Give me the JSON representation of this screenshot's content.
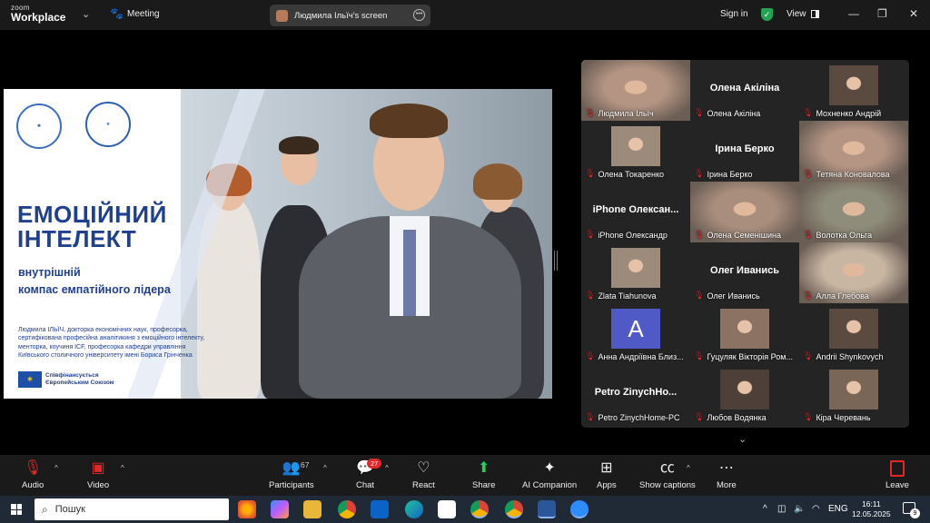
{
  "topbar": {
    "logo_line1": "zoom",
    "logo_line2": "Workplace",
    "meeting_label": "Meeting",
    "screen_share_label": "Людмила Ільїч's screen",
    "sign_in": "Sign in",
    "view_label": "View",
    "minimize": "—",
    "restore": "❐",
    "close": "✕"
  },
  "slide": {
    "title_line1": "ЕМОЦІЙНИЙ",
    "title_line2": "ІНТЕЛЕКТ",
    "subtitle_line1": "внутрішній",
    "subtitle_line2": "компас емпатійного лідера",
    "author_line1": "Людмила ІЛЬЇЧ, докторка економічних наук, професорка,",
    "author_line2": "сертифікована професійна аналітикиня з емоційного інтелекту,",
    "author_line3": "менторка, коучиня ICF, професорка кафедри управління",
    "author_line4": "Київського столичного університету імені Бориса Грінченка",
    "eu_line1": "Співфінансується",
    "eu_line2": "Європейським Союзом"
  },
  "gallery": {
    "tiles": [
      {
        "name": "Людмила Ільїч",
        "kind": "video",
        "active": true
      },
      {
        "name": "Олена Акіліна",
        "kind": "name",
        "big": "Олена Акіліна"
      },
      {
        "name": "Мохненко Андрій",
        "kind": "photo"
      },
      {
        "name": "Олена Токаренко",
        "kind": "photo"
      },
      {
        "name": "Ірина Берко",
        "kind": "name",
        "big": "Ірина Берко"
      },
      {
        "name": "Тетяна Коновалова",
        "kind": "video"
      },
      {
        "name": "iPhone Олександр",
        "kind": "name",
        "big": "iPhone Олексан..."
      },
      {
        "name": "Олена Семенішина",
        "kind": "video"
      },
      {
        "name": "Волотка Ольга",
        "kind": "video"
      },
      {
        "name": "Zlata Tiahunova",
        "kind": "photo"
      },
      {
        "name": "Олег Иванись",
        "kind": "name",
        "big": "Олег Иванись"
      },
      {
        "name": "Алла Глебова",
        "kind": "video"
      },
      {
        "name": "Анна Андріївна Близ...",
        "kind": "avatar",
        "letter": "A"
      },
      {
        "name": "Гуцуляк Вікторія Ром...",
        "kind": "photo"
      },
      {
        "name": "Andrii Shynkovych",
        "kind": "photo"
      },
      {
        "name": "Petro ZinychHome-PC",
        "kind": "name",
        "big": "Petro  ZinychHo..."
      },
      {
        "name": "Любов Водянка",
        "kind": "photo"
      },
      {
        "name": "Кіра Черевань",
        "kind": "photo"
      }
    ]
  },
  "toolbar": {
    "audio": "Audio",
    "video": "Video",
    "participants": "Participants",
    "participants_count": "67",
    "chat": "Chat",
    "chat_badge": "27",
    "react": "React",
    "share": "Share",
    "ai_companion": "AI Companion",
    "apps": "Apps",
    "show_captions": "Show captions",
    "more": "More",
    "leave": "Leave"
  },
  "taskbar": {
    "search_placeholder": "Пошук",
    "language": "ENG",
    "time": "16:11",
    "date": "12.05.2025",
    "notifications": "9"
  },
  "colors": {
    "active_speaker": "#23d160",
    "slide_blue": "#1f3f8f",
    "muted_red": "#e02828",
    "share_green": "#23d160"
  }
}
